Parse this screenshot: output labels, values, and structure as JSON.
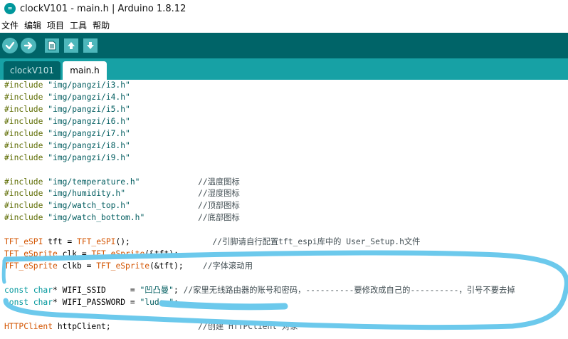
{
  "window": {
    "title": "clockV101 - main.h | Arduino 1.8.12",
    "app_icon": "arduino-infinity-icon",
    "app_icon_symbol": "∞"
  },
  "menu": [
    "文件",
    "编辑",
    "项目",
    "工具",
    "帮助"
  ],
  "toolbar": {
    "buttons": [
      "verify-icon",
      "upload-icon",
      "new-icon",
      "open-icon",
      "save-icon"
    ]
  },
  "tabs": [
    {
      "label": "clockV101",
      "active": false
    },
    {
      "label": "main.h",
      "active": true
    }
  ],
  "colors": {
    "toolbar_bg": "#006468",
    "tabbar_bg": "#17a1a5",
    "button_fill": "#4db7bb",
    "annotation_stroke": "#6cc9ec",
    "preprocessor": "#5e6d03",
    "string": "#005c5f",
    "type": "#d35400",
    "keyword": "#00979c"
  },
  "code": {
    "lines": [
      [
        {
          "t": "#include ",
          "c": "pre"
        },
        {
          "t": "\"img/pangzi/i3.h\"",
          "c": "str"
        }
      ],
      [
        {
          "t": "#include ",
          "c": "pre"
        },
        {
          "t": "\"img/pangzi/i4.h\"",
          "c": "str"
        }
      ],
      [
        {
          "t": "#include ",
          "c": "pre"
        },
        {
          "t": "\"img/pangzi/i5.h\"",
          "c": "str"
        }
      ],
      [
        {
          "t": "#include ",
          "c": "pre"
        },
        {
          "t": "\"img/pangzi/i6.h\"",
          "c": "str"
        }
      ],
      [
        {
          "t": "#include ",
          "c": "pre"
        },
        {
          "t": "\"img/pangzi/i7.h\"",
          "c": "str"
        }
      ],
      [
        {
          "t": "#include ",
          "c": "pre"
        },
        {
          "t": "\"img/pangzi/i8.h\"",
          "c": "str"
        }
      ],
      [
        {
          "t": "#include ",
          "c": "pre"
        },
        {
          "t": "\"img/pangzi/i9.h\"",
          "c": "str"
        }
      ],
      [],
      [
        {
          "t": "#include ",
          "c": "pre"
        },
        {
          "t": "\"img/temperature.h\"",
          "c": "str"
        },
        {
          "t": "            //温度图标",
          "c": "cmt"
        }
      ],
      [
        {
          "t": "#include ",
          "c": "pre"
        },
        {
          "t": "\"img/humidity.h\"",
          "c": "str"
        },
        {
          "t": "               //湿度图标",
          "c": "cmt"
        }
      ],
      [
        {
          "t": "#include ",
          "c": "pre"
        },
        {
          "t": "\"img/watch_top.h\"",
          "c": "str"
        },
        {
          "t": "              //顶部图标",
          "c": "cmt"
        }
      ],
      [
        {
          "t": "#include ",
          "c": "pre"
        },
        {
          "t": "\"img/watch_bottom.h\"",
          "c": "str"
        },
        {
          "t": "           //底部图标",
          "c": "cmt"
        }
      ],
      [],
      [
        {
          "t": "TFT_eSPI",
          "c": "type"
        },
        {
          "t": " tft = ",
          "c": "plain"
        },
        {
          "t": "TFT_eSPI",
          "c": "type"
        },
        {
          "t": "();                 ",
          "c": "plain"
        },
        {
          "t": "//引脚请自行配置tft_espi库中的 User_Setup.h文件",
          "c": "cmt"
        }
      ],
      [
        {
          "t": "TFT_eSprite",
          "c": "type"
        },
        {
          "t": " clk = ",
          "c": "plain"
        },
        {
          "t": "TFT_eSprite",
          "c": "type"
        },
        {
          "t": "(&tft);",
          "c": "plain"
        }
      ],
      [
        {
          "t": "TFT_eSprite",
          "c": "type"
        },
        {
          "t": " clkb = ",
          "c": "plain"
        },
        {
          "t": "TFT_eSprite",
          "c": "type"
        },
        {
          "t": "(&tft);    ",
          "c": "plain"
        },
        {
          "t": "//字体滚动用",
          "c": "cmt"
        }
      ],
      [],
      [
        {
          "t": "const",
          "c": "kw"
        },
        {
          "t": " ",
          "c": "plain"
        },
        {
          "t": "char",
          "c": "kw"
        },
        {
          "t": "* WIFI_SSID     = ",
          "c": "plain"
        },
        {
          "t": "\"凹凸曼\"",
          "c": "str"
        },
        {
          "t": "; ",
          "c": "plain"
        },
        {
          "t": "//家里无线路由器的账号和密码，----------要修改成自己的----------，引号不要去掉",
          "c": "cmt"
        }
      ],
      [
        {
          "t": "const",
          "c": "kw"
        },
        {
          "t": " ",
          "c": "plain"
        },
        {
          "t": "char",
          "c": "kw"
        },
        {
          "t": "* WIFI_PASSWORD = ",
          "c": "plain"
        },
        {
          "t": "\"ludo",
          "c": "str"
        },
        {
          "t": "…",
          "c": "str"
        },
        {
          "t": "\"",
          "c": "str"
        },
        {
          "t": ";",
          "c": "plain"
        }
      ],
      [],
      [
        {
          "t": "HTTPClient",
          "c": "type"
        },
        {
          "t": " httpClient;                  ",
          "c": "plain"
        },
        {
          "t": "//创建 HTTPClient 对象",
          "c": "cmt"
        }
      ]
    ]
  }
}
